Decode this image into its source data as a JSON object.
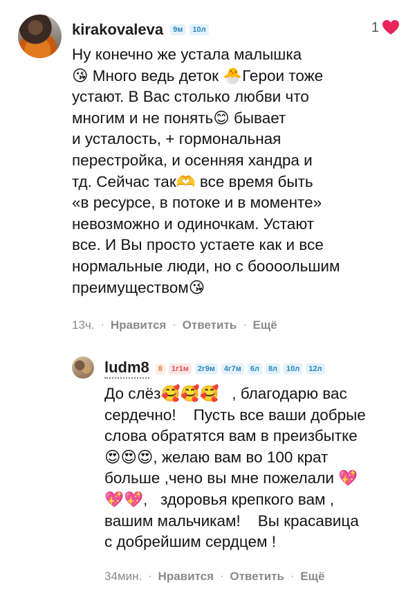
{
  "main_comment": {
    "username": "kirakovaleva",
    "badges": [
      "9м",
      "10л"
    ],
    "like_count": "1",
    "text": "Ну конечно же устала малышка\n😘 Много ведь деток 🐣Герои тоже\nустают. В Вас столько любви что\nмногим и не понять😊 бывает\nи усталость, + гормональная\nперестройка, и осенняя хандра и\nтд. Сейчас так🫶 все время быть\n«в ресурсе, в потоке и в моменте»\nневозможно и одиночкам. Устают\nвсе. И Вы просто устаете как и все\nнормальные люди, но с боооольшим\nпреимуществом😘",
    "time": "13ч.",
    "like_label": "Нравится",
    "reply_label": "Ответить",
    "more_label": "Ещё"
  },
  "reply_comment": {
    "username": "ludm8",
    "badges": [
      "8",
      "1г1м",
      "2г9м",
      "4г7м",
      "6л",
      "8л",
      "10л",
      "12л"
    ],
    "text": "До слёз🥰🥰🥰   , благодарю вас\nсердечно!    Пусть все ваши добрые\nслова обратятся вам в преизбытке\n😍😍😍, желаю вам во 100 крат\nбольше ,чено вы мне пожелали 💖\n💖💖,   здоровья крепкого вам ,\nвашим мальчикам!    Вы красавица\nс добрейшим сердцем !",
    "time": "34мин.",
    "like_label": "Нравится",
    "reply_label": "Ответить",
    "more_label": "Ещё"
  },
  "colors": {
    "heart": "#e8245a",
    "badge_blue": "#2d86b8",
    "badge_orange": "#e07b39",
    "badge_red": "#e05454"
  },
  "icons": {
    "like": "heart-icon"
  }
}
